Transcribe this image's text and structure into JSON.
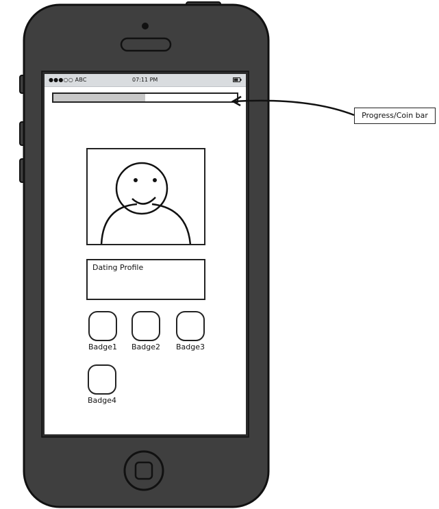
{
  "status_bar": {
    "carrier": "●●●○○ ABC",
    "time": "07:11 PM",
    "battery_icon": "battery-icon"
  },
  "progress_bar": {
    "fill_fraction": 0.5,
    "fill_color": "#c8c8c8"
  },
  "avatar": {
    "icon": "user-avatar-icon"
  },
  "profile": {
    "label": "Dating Profile"
  },
  "badges": [
    {
      "label": "Badge1"
    },
    {
      "label": "Badge2"
    },
    {
      "label": "Badge3"
    },
    {
      "label": "Badge4"
    }
  ],
  "annotation": {
    "label": "Progress/Coin bar"
  },
  "colors": {
    "phone_body": "#3f3f3f",
    "phone_outline": "#111111",
    "status_bar_bg": "#d9dcdf",
    "screen_bg": "#ffffff"
  }
}
